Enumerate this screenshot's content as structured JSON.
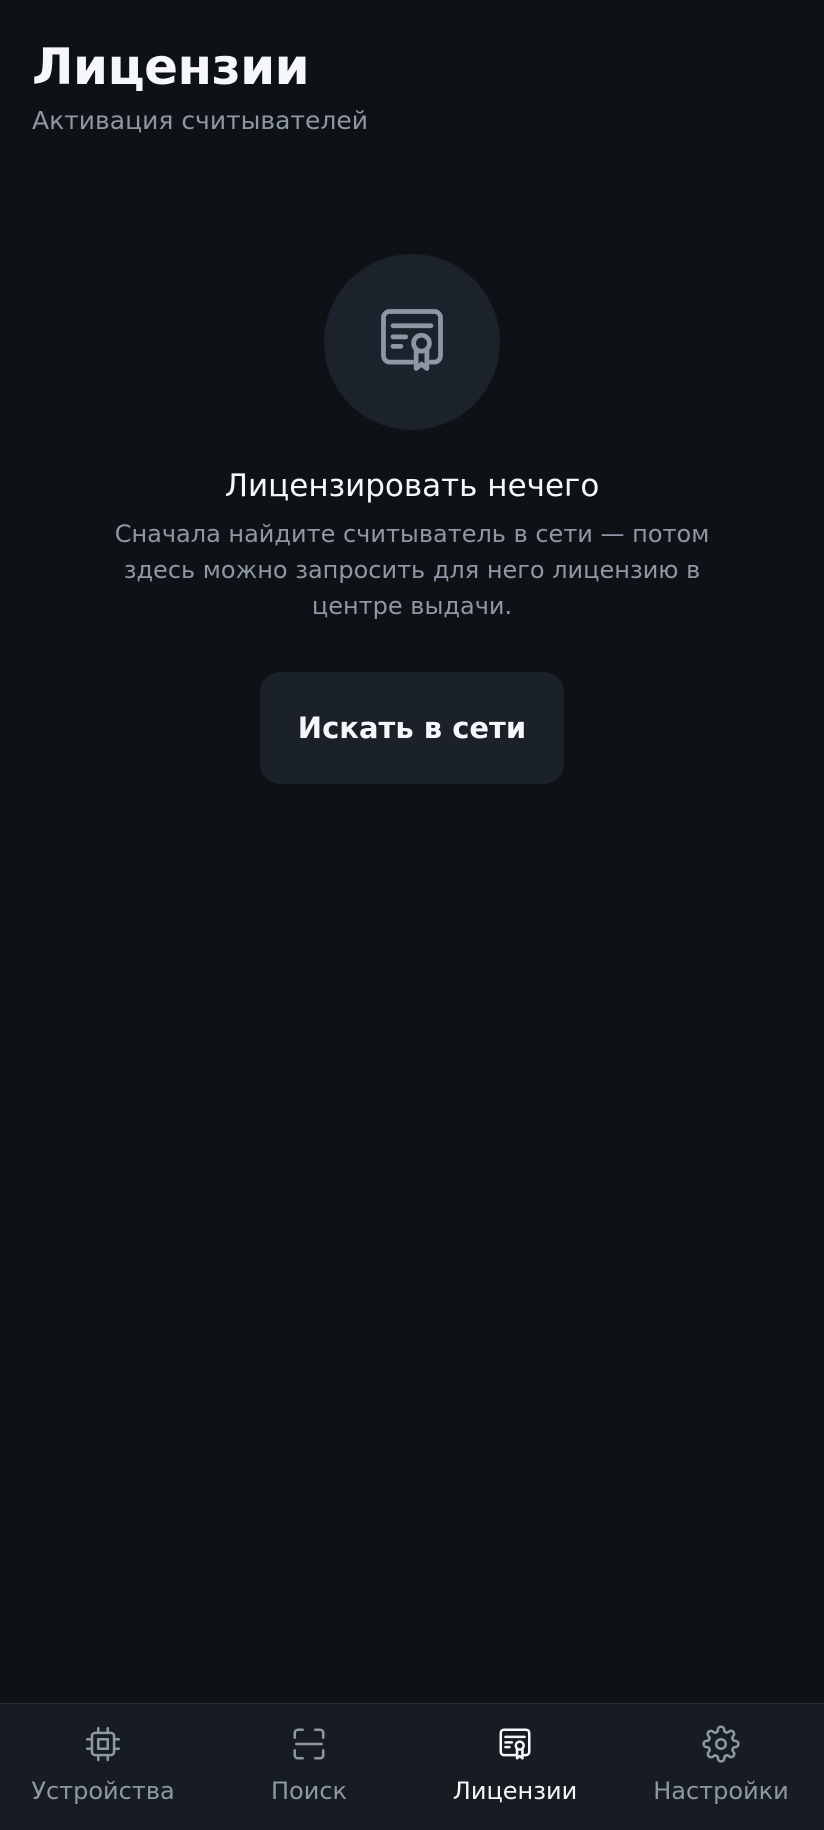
{
  "header": {
    "title": "Лицензии",
    "subtitle": "Активация считывателей"
  },
  "empty_state": {
    "icon": "certificate-icon",
    "title": "Лицензировать нечего",
    "description": "Сначала найдите считыватель в сети — потом здесь можно запросить для него лицензию в центре выдачи.",
    "button_label": "Искать в сети"
  },
  "bottom_nav": {
    "items": [
      {
        "label": "Устройства",
        "icon": "chip-icon",
        "active": false
      },
      {
        "label": "Поиск",
        "icon": "scan-icon",
        "active": false
      },
      {
        "label": "Лицензии",
        "icon": "certificate-icon",
        "active": true
      },
      {
        "label": "Настройки",
        "icon": "gear-icon",
        "active": false
      }
    ]
  },
  "colors": {
    "background": "#0e1116",
    "surface": "#1b2129",
    "text_primary": "#f5f7fa",
    "text_secondary": "#8e97a4"
  }
}
